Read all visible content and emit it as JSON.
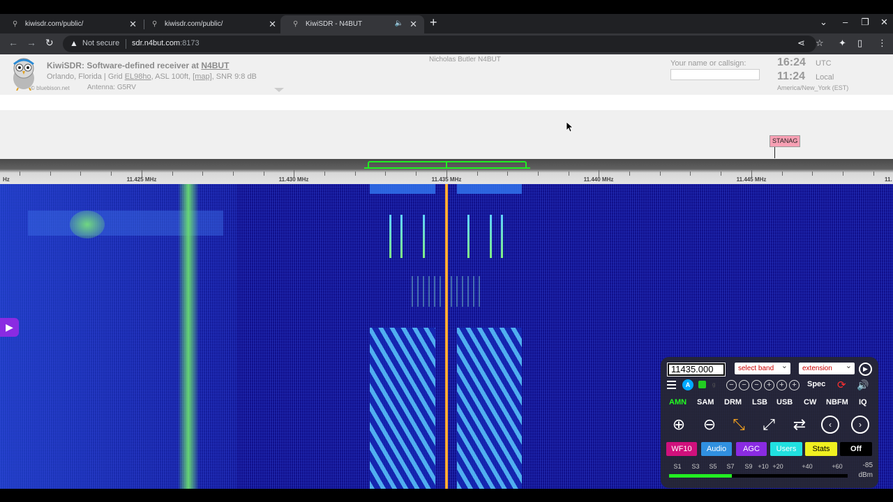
{
  "browser": {
    "tabs": [
      {
        "title": "kiwisdr.com/public/",
        "close": "✕"
      },
      {
        "title": "kiwisdr.com/public/",
        "close": "✕"
      },
      {
        "title": "KiwiSDR - N4BUT",
        "close": "✕",
        "audio_icon": "speaker-icon"
      }
    ],
    "new_tab": "+",
    "address": {
      "security_label": "Not secure",
      "host": "sdr.n4but.com",
      "port": ":8173"
    }
  },
  "header": {
    "title_prefix": "KiwiSDR: Software-defined receiver at ",
    "callsign": "N4BUT",
    "location_prefix": "Orlando, Florida | Grid ",
    "grid": "EL98ho",
    "location_mid": ", ASL 100ft, ",
    "map_link": "[map]",
    "snr": ", SNR 9:8 dB",
    "antenna": "Antenna: G5RV",
    "credit": "© bluebison.net",
    "owner": "Nicholas Butler N4BUT",
    "callsign_label": "Your name or callsign:",
    "callsign_value": "",
    "utc_time": "16:24",
    "utc_label": "UTC",
    "local_time": "11:24",
    "local_label": "Local",
    "region": "America/New_York (EST)"
  },
  "dx_label": {
    "text": "STANAG",
    "color": "#f8a0b4"
  },
  "scale": {
    "labels": [
      {
        "text": "Hz"
      },
      {
        "text": "11.425 MHz"
      },
      {
        "text": "11.430 MHz"
      },
      {
        "text": "11.435 MHz"
      },
      {
        "text": "11.440 MHz"
      },
      {
        "text": "11.445 MHz"
      },
      {
        "text": "11."
      }
    ],
    "passband_color": "#22ee22"
  },
  "controls": {
    "frequency": "11435.000",
    "select_band": "select band",
    "extension": "extension",
    "a_label": "A",
    "g_label": "g",
    "spec_label": "Spec",
    "modes": [
      "AMN",
      "SAM",
      "DRM",
      "LSB",
      "USB",
      "CW",
      "NBFM",
      "IQ"
    ],
    "active_mode": "AMN",
    "panel_buttons": [
      {
        "label": "WF10",
        "color": "#d0107c"
      },
      {
        "label": "Audio",
        "color": "#3090e0"
      },
      {
        "label": "AGC",
        "color": "#8a2be2"
      },
      {
        "label": "Users",
        "color": "#20e0e0"
      },
      {
        "label": "Stats",
        "color": "#f0f020"
      },
      {
        "label": "Off",
        "color": "#000000"
      }
    ],
    "smeter": {
      "labels": [
        "S1",
        "S3",
        "S5",
        "S7",
        "S9",
        "+10",
        "+20",
        "+40",
        "+60"
      ],
      "value": "-85",
      "unit": "dBm",
      "level": 0.35
    }
  }
}
